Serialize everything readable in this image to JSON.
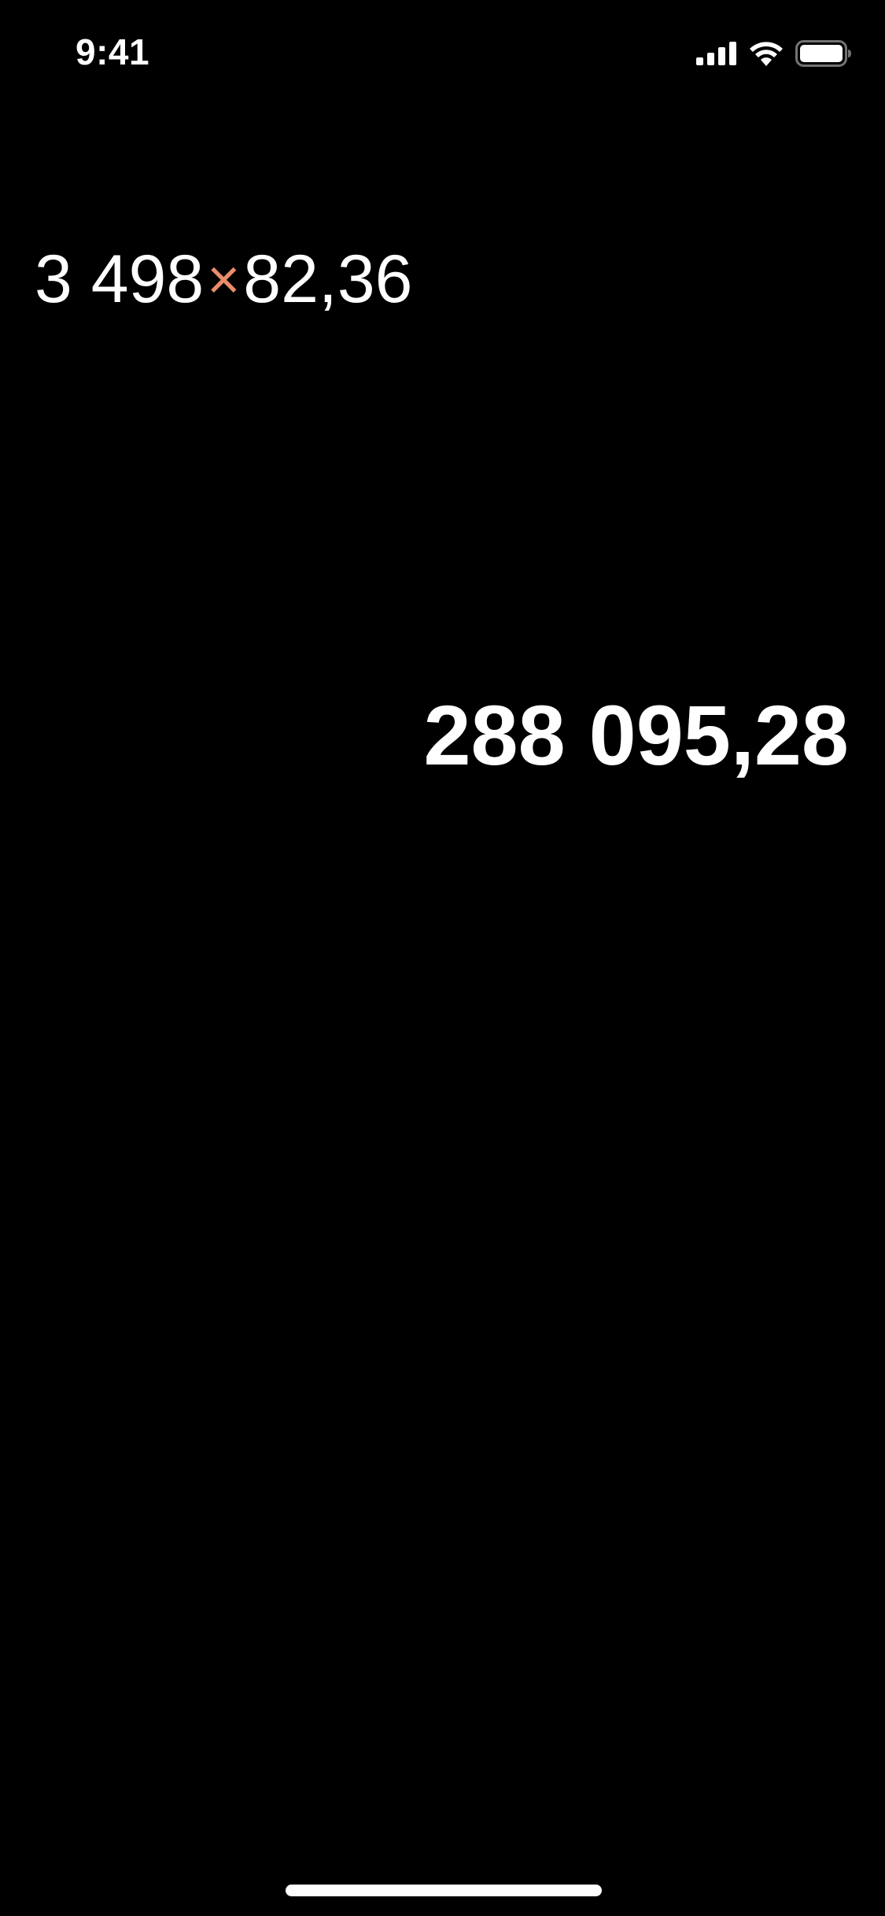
{
  "status_bar": {
    "time": "9:41",
    "icons": [
      "cellular-signal-icon",
      "wifi-icon",
      "battery-icon"
    ]
  },
  "calculator": {
    "expression": {
      "operand_1": "3 498",
      "operator": "×",
      "operand_2": "82,36"
    },
    "result": "288 095,28"
  },
  "colors": {
    "background": "#000000",
    "text": "#ffffff",
    "operator_accent": "#e98d6a"
  }
}
